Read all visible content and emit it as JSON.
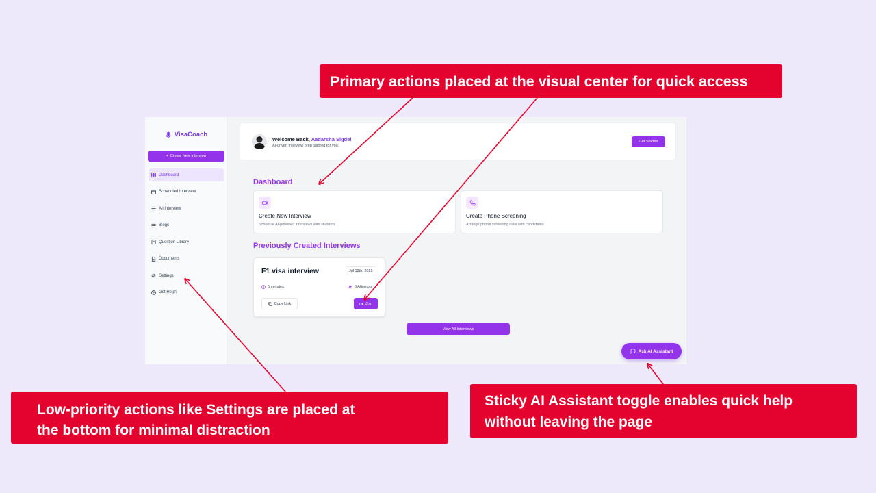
{
  "app": {
    "brand": "VisaCoach",
    "create_button": "Create New Interview",
    "nav": [
      {
        "label": "Dashboard",
        "icon": "dashboard-icon",
        "active": true
      },
      {
        "label": "Scheduled Interview",
        "icon": "calendar-icon"
      },
      {
        "label": "All Interview",
        "icon": "list-icon"
      },
      {
        "label": "Blogs",
        "icon": "list-icon"
      },
      {
        "label": "Question Library",
        "icon": "book-icon"
      },
      {
        "label": "Documents",
        "icon": "document-icon"
      },
      {
        "label": "Settings",
        "icon": "gear-icon"
      },
      {
        "label": "Get Help?",
        "icon": "help-icon"
      }
    ],
    "welcome": {
      "greeting": "Welcome Back,",
      "name": "Aadarsha Sigdel",
      "subtitle": "AI-driven interview prep tailored for you.",
      "cta": "Get Started"
    },
    "dashboard": {
      "title": "Dashboard",
      "cards": [
        {
          "title": "Create New Interview",
          "subtitle": "Schedule AI-powered interviews with students",
          "icon": "video-icon"
        },
        {
          "title": "Create Phone Screening",
          "subtitle": "Arrange phone screening calls with candidates",
          "icon": "phone-icon"
        }
      ]
    },
    "previous": {
      "title": "Previously Created Interviews",
      "interview": {
        "title": "F1 visa interview",
        "date": "Jul 12th, 2025",
        "duration": "5 minutes",
        "attempts": "0 Attempts",
        "copy_label": "Copy Link",
        "join_label": "Join"
      },
      "view_all": "View All Interviews"
    },
    "ai_assistant": "Ask AI Assistant"
  },
  "annotations": {
    "top": "Primary actions placed at the visual center for quick access",
    "left_line1": "Low-priority actions like Settings are placed at",
    "left_line2": "the bottom for minimal distraction",
    "right_line1": "Sticky AI Assistant toggle enables quick help",
    "right_line2": "without leaving the page"
  },
  "colors": {
    "accent": "#9333ea",
    "annotation": "#e4032e",
    "background": "#ede9fb"
  }
}
